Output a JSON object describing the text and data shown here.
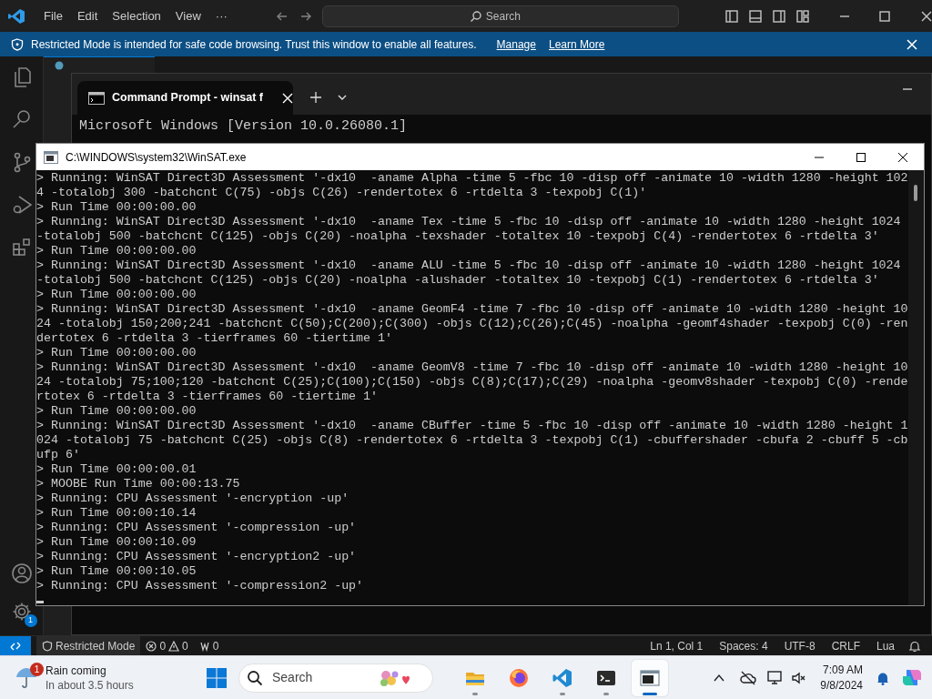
{
  "vscode": {
    "menu": [
      "File",
      "Edit",
      "Selection",
      "View",
      "···"
    ],
    "search": {
      "placeholder": "Search"
    },
    "banner": {
      "message": "Restricted Mode is intended for safe code browsing. Trust this window to enable all features.",
      "links": [
        "Manage",
        "Learn More"
      ]
    },
    "activity_bar": {
      "settings_badge": "1"
    },
    "status_bar": {
      "mode": "Restricted Mode",
      "errors": "0",
      "warnings": "0",
      "ports": "0",
      "right": [
        "Ln 1, Col 1",
        "Spaces: 4",
        "UTF-8",
        "CRLF",
        "Lua"
      ]
    }
  },
  "terminal": {
    "tab_title": "Command Prompt - winsat  f",
    "lines": [
      "Microsoft Windows [Version 10.0.26080.1]"
    ]
  },
  "console": {
    "title": "C:\\WINDOWS\\system32\\WinSAT.exe",
    "lines": [
      "> Running: WinSAT Direct3D Assessment '-dx10  -aname Alpha -time 5 -fbc 10 -disp off -animate 10 -width 1280 -height 1024 -totalobj 300 -batchcnt C(75) -objs C(26) -rendertotex 6 -rtdelta 3 -texpobj C(1)'",
      "> Run Time 00:00:00.00",
      "> Running: WinSAT Direct3D Assessment '-dx10  -aname Tex -time 5 -fbc 10 -disp off -animate 10 -width 1280 -height 1024 -totalobj 500 -batchcnt C(125) -objs C(20) -noalpha -texshader -totaltex 10 -texpobj C(4) -rendertotex 6 -rtdelta 3'",
      "> Run Time 00:00:00.00",
      "> Running: WinSAT Direct3D Assessment '-dx10  -aname ALU -time 5 -fbc 10 -disp off -animate 10 -width 1280 -height 1024 -totalobj 500 -batchcnt C(125) -objs C(20) -noalpha -alushader -totaltex 10 -texpobj C(1) -rendertotex 6 -rtdelta 3'",
      "> Run Time 00:00:00.00",
      "> Running: WinSAT Direct3D Assessment '-dx10  -aname GeomF4 -time 7 -fbc 10 -disp off -animate 10 -width 1280 -height 1024 -totalobj 150;200;241 -batchcnt C(50);C(200);C(300) -objs C(12);C(26);C(45) -noalpha -geomf4shader -texpobj C(0) -rendertotex 6 -rtdelta 3 -tierframes 60 -tiertime 1'",
      "> Run Time 00:00:00.00",
      "> Running: WinSAT Direct3D Assessment '-dx10  -aname GeomV8 -time 7 -fbc 10 -disp off -animate 10 -width 1280 -height 1024 -totalobj 75;100;120 -batchcnt C(25);C(100);C(150) -objs C(8);C(17);C(29) -noalpha -geomv8shader -texpobj C(0) -rendertotex 6 -rtdelta 3 -tierframes 60 -tiertime 1'",
      "> Run Time 00:00:00.00",
      "> Running: WinSAT Direct3D Assessment '-dx10  -aname CBuffer -time 5 -fbc 10 -disp off -animate 10 -width 1280 -height 1024 -totalobj 75 -batchcnt C(25) -objs C(8) -rendertotex 6 -rtdelta 3 -texpobj C(1) -cbuffershader -cbufa 2 -cbuff 5 -cbufp 6'",
      "> Run Time 00:00:00.01",
      "> MOOBE Run Time 00:00:13.75",
      "> Running: CPU Assessment '-encryption -up'",
      "> Run Time 00:00:10.14",
      "> Running: CPU Assessment '-compression -up'",
      "> Run Time 00:00:10.09",
      "> Running: CPU Assessment '-encryption2 -up'",
      "> Run Time 00:00:10.05",
      "> Running: CPU Assessment '-compression2 -up'"
    ]
  },
  "taskbar": {
    "weather": {
      "title": "Rain coming",
      "subtitle": "In about 3.5 hours",
      "badge": "1"
    },
    "search": {
      "placeholder": "Search"
    },
    "apps": [
      {
        "kind": "folder",
        "running": true,
        "selected": false
      },
      {
        "kind": "firefox",
        "running": false,
        "selected": false
      },
      {
        "kind": "vscode",
        "running": true,
        "selected": false
      },
      {
        "kind": "terminal",
        "running": true,
        "selected": false
      },
      {
        "kind": "console",
        "running": true,
        "selected": true
      }
    ],
    "clock": {
      "time": "7:09 AM",
      "date": "9/8/2024"
    }
  }
}
